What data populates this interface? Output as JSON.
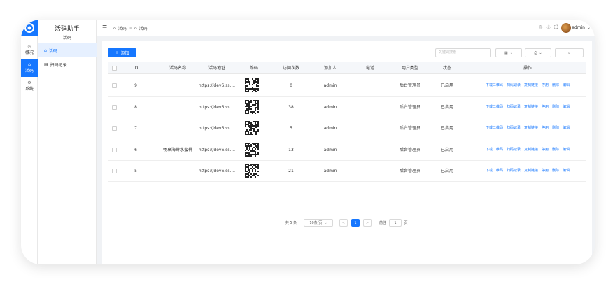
{
  "app": {
    "title": "活码助手",
    "subtitle": "活码"
  },
  "rail": [
    {
      "icon": "clock-icon",
      "label": "概况",
      "active": false
    },
    {
      "icon": "qrcode-icon",
      "label": "活码",
      "active": true
    },
    {
      "icon": "gear-icon",
      "label": "系统",
      "active": false
    }
  ],
  "submenu": [
    {
      "label": "活码",
      "active": true
    },
    {
      "label": "扫码记录",
      "active": false
    }
  ],
  "header": {
    "breadcrumb": [
      "活码",
      "活码"
    ],
    "username": "admin"
  },
  "toolbar": {
    "add_label": "添加",
    "search_placeholder": "关键词搜索"
  },
  "table": {
    "columns": [
      "ID",
      "活码名称",
      "活码地址",
      "二维码",
      "访问次数",
      "添加人",
      "电话",
      "用户类型",
      "状态",
      "操作"
    ],
    "actions": [
      "下载二维码",
      "扫码记录",
      "复制链接",
      "停用",
      "删除",
      "编辑"
    ],
    "rows": [
      {
        "id": "9",
        "name": "",
        "url": "https://dev6.ss....",
        "visits": "0",
        "adder": "admin",
        "phone": "",
        "user_type": "后台管理员",
        "status": "已启用"
      },
      {
        "id": "8",
        "name": "",
        "url": "https://dev6.ss....",
        "visits": "38",
        "adder": "admin",
        "phone": "",
        "user_type": "后台管理员",
        "status": "已启用"
      },
      {
        "id": "7",
        "name": "",
        "url": "https://dev6.ss....",
        "visits": "5",
        "adder": "admin",
        "phone": "",
        "user_type": "后台管理员",
        "status": "已启用"
      },
      {
        "id": "6",
        "name": "畅享海藓水蜜桃",
        "url": "https://dev6.ss....",
        "visits": "13",
        "adder": "admin",
        "phone": "",
        "user_type": "后台管理员",
        "status": "已启用"
      },
      {
        "id": "5",
        "name": "",
        "url": "https://dev6.ss....",
        "visits": "21",
        "adder": "admin",
        "phone": "",
        "user_type": "后台管理员",
        "status": "已启用"
      }
    ]
  },
  "pagination": {
    "total": "共 5 条",
    "page_size": "10条/页",
    "current": "1",
    "goto_label": "前往",
    "goto_value": "1",
    "page_unit": "页"
  },
  "colors": {
    "accent": "#1677ff"
  }
}
